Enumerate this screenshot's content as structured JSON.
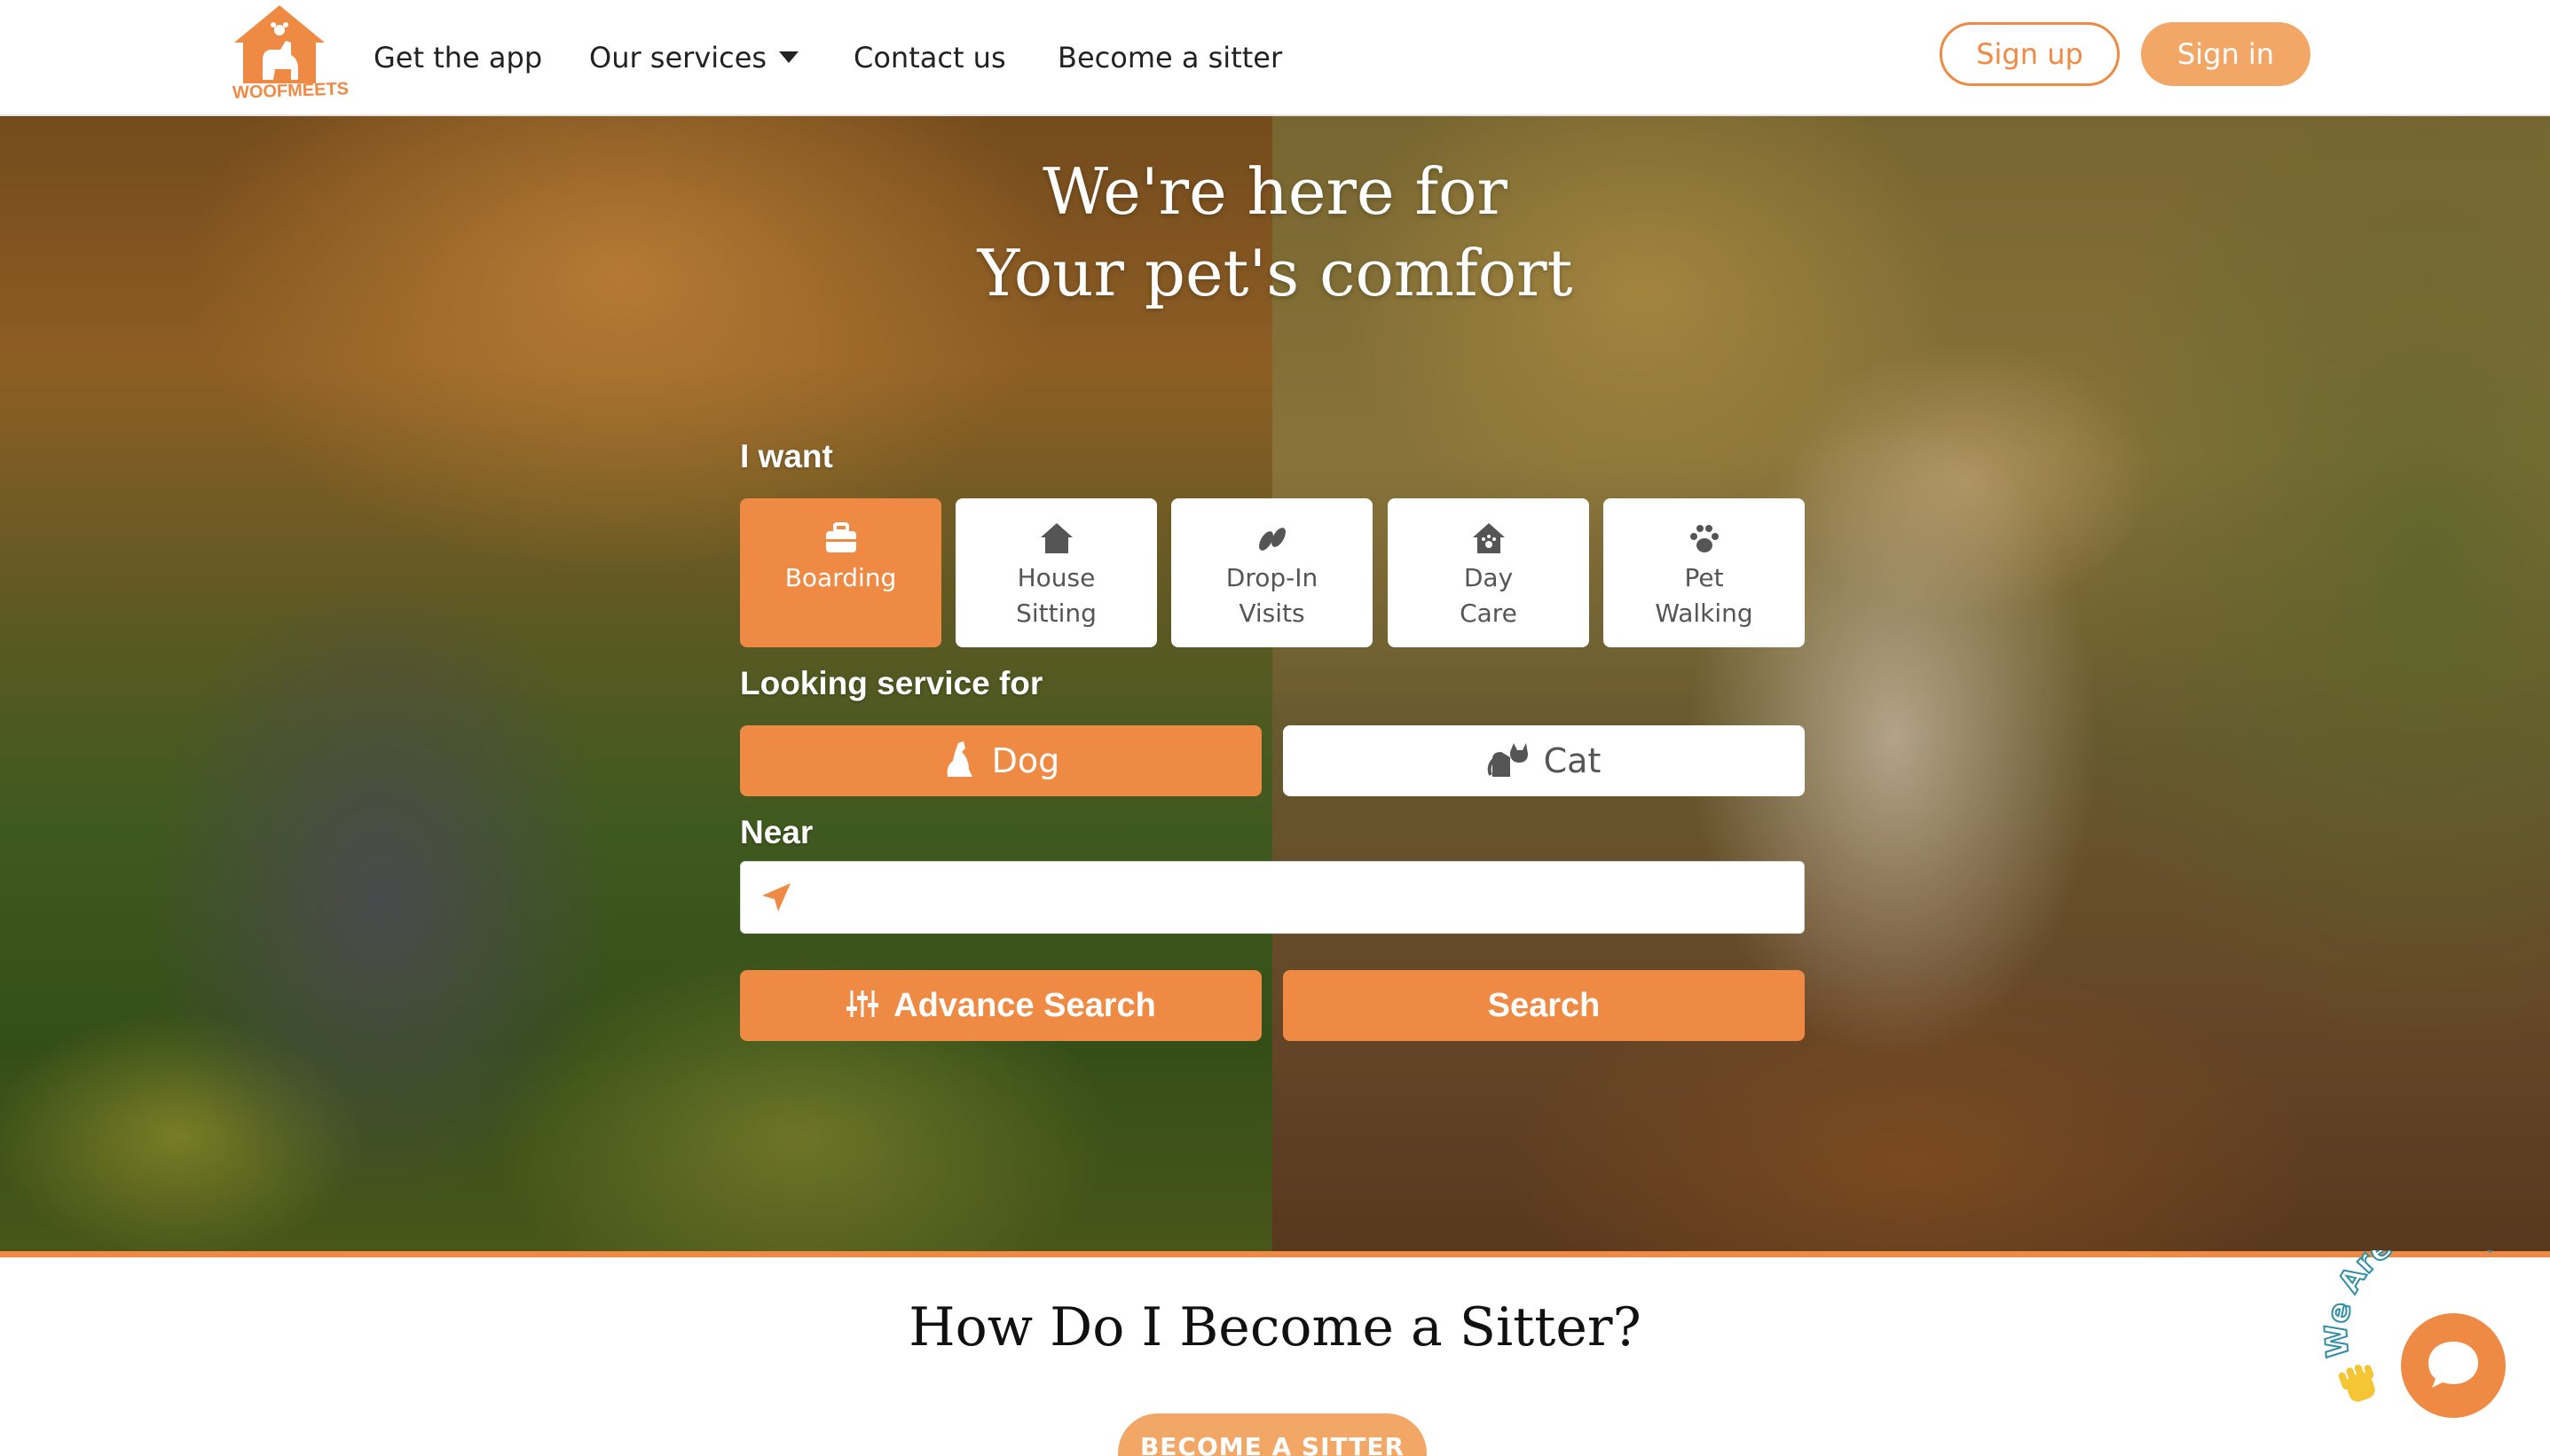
{
  "header": {
    "logo_text": "WOOFMEETS",
    "nav": [
      {
        "label": "Get the app"
      },
      {
        "label": "Our services"
      },
      {
        "label": "Contact us"
      },
      {
        "label": "Become a sitter"
      }
    ],
    "signup_label": "Sign up",
    "signin_label": "Sign in"
  },
  "hero": {
    "title_line1": "We're here for",
    "title_line2": "Your pet's comfort",
    "want_label": "I want",
    "services": [
      {
        "line1": "Boarding",
        "line2": "",
        "icon": "briefcase-icon",
        "selected": true
      },
      {
        "line1": "House",
        "line2": "Sitting",
        "icon": "house-icon",
        "selected": false
      },
      {
        "line1": "Drop-In",
        "line2": "Visits",
        "icon": "shoe-prints-icon",
        "selected": false
      },
      {
        "line1": "Day",
        "line2": "Care",
        "icon": "house-paw-icon",
        "selected": false
      },
      {
        "line1": "Pet",
        "line2": "Walking",
        "icon": "paw-icon",
        "selected": false
      }
    ],
    "looking_label": "Looking service for",
    "pets": [
      {
        "label": "Dog",
        "icon": "dog-icon",
        "selected": true
      },
      {
        "label": "Cat",
        "icon": "cat-icon",
        "selected": false
      }
    ],
    "near_label": "Near",
    "near_value": "",
    "near_placeholder": "",
    "advance_search_label": "Advance Search",
    "search_label": "Search"
  },
  "section": {
    "title": "How Do I Become a Sitter?",
    "button_label": "BECOME A SITTER"
  },
  "chat": {
    "badge_text": "We Are Here!"
  },
  "colors": {
    "accent": "#ee8a43",
    "accent_light": "#f2a766"
  }
}
